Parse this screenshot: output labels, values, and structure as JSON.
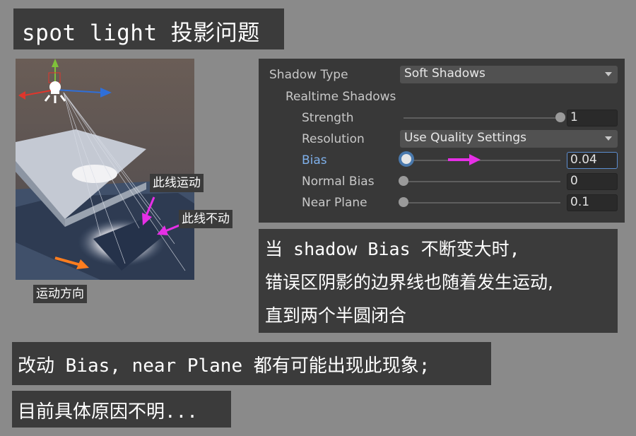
{
  "title": "spot light 投影问题",
  "scene": {
    "label_moving": "此线运动",
    "label_fixed": "此线不动",
    "label_direction": "运动方向",
    "colors": {
      "background": "#5f5450",
      "box_top": "#c6cbd4",
      "box_side": "#9ea6b2",
      "floor": "#40506a",
      "shadow": "#2d3a4f",
      "gizmo_x": "#e0362c",
      "gizmo_y": "#7fc13a",
      "gizmo_z": "#2f6fd8",
      "annotation_magenta": "#e62fe6",
      "annotation_orange": "#ff7d1e"
    }
  },
  "inspector": {
    "shadow_type": {
      "label": "Shadow Type",
      "value": "Soft Shadows"
    },
    "realtime_shadows": {
      "label": "Realtime Shadows"
    },
    "strength": {
      "label": "Strength",
      "value": "1",
      "level": 1.0
    },
    "resolution": {
      "label": "Resolution",
      "value": "Use Quality Settings"
    },
    "bias": {
      "label": "Bias",
      "value": "0.04",
      "level": 0.02
    },
    "normal_bias": {
      "label": "Normal Bias",
      "value": "0",
      "level": 0.0
    },
    "near_plane": {
      "label": "Near Plane",
      "value": "0.1",
      "level": 0.0
    },
    "colors": {
      "panel": "#383838",
      "active_label": "#7fb0ea",
      "focus": "#4a79ad"
    }
  },
  "explanation": {
    "line1": "当 shadow Bias 不断变大时,",
    "line2": "错误区阴影的边界线也随着发生运动,",
    "line3": "直到两个半圆闭合"
  },
  "note1": "改动 Bias, near Plane 都有可能出现此现象;",
  "note2": "目前具体原因不明..."
}
